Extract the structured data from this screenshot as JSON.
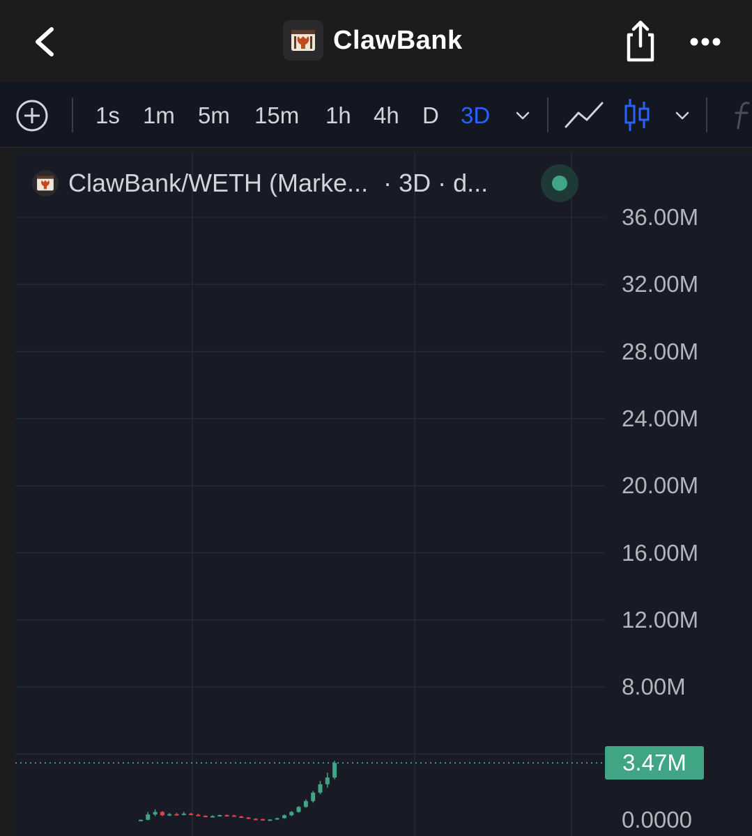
{
  "navbar": {
    "title": "ClawBank"
  },
  "toolbar": {
    "timeframes": [
      "1s",
      "1m",
      "5m",
      "15m",
      "1h",
      "4h",
      "D",
      "3D"
    ],
    "active_timeframe": "3D"
  },
  "legend": {
    "symbol": "ClawBank/WETH (Marke...",
    "meta": "· 3D · d..."
  },
  "colors": {
    "accent": "#2962ff",
    "up": "#3fa584",
    "down": "#e0444f",
    "background": "#181a25"
  },
  "chart_data": {
    "type": "candlestick",
    "y_ticks": [
      "36.00M",
      "32.00M",
      "28.00M",
      "24.00M",
      "20.00M",
      "16.00M",
      "12.00M",
      "8.00M",
      "0.0000"
    ],
    "last_price_label": "3.47M",
    "last_price": 3470000,
    "ylim": [
      0,
      36000000
    ],
    "candles": [
      {
        "o": 0.05,
        "h": 0.1,
        "l": 0.02,
        "c": 0.08
      },
      {
        "o": 0.08,
        "h": 0.55,
        "l": 0.06,
        "c": 0.4
      },
      {
        "o": 0.4,
        "h": 0.7,
        "l": 0.3,
        "c": 0.55
      },
      {
        "o": 0.55,
        "h": 0.6,
        "l": 0.3,
        "c": 0.35
      },
      {
        "o": 0.35,
        "h": 0.48,
        "l": 0.3,
        "c": 0.42
      },
      {
        "o": 0.42,
        "h": 0.5,
        "l": 0.38,
        "c": 0.4
      },
      {
        "o": 0.4,
        "h": 0.55,
        "l": 0.35,
        "c": 0.45
      },
      {
        "o": 0.45,
        "h": 0.5,
        "l": 0.35,
        "c": 0.38
      },
      {
        "o": 0.38,
        "h": 0.45,
        "l": 0.3,
        "c": 0.32
      },
      {
        "o": 0.32,
        "h": 0.35,
        "l": 0.25,
        "c": 0.28
      },
      {
        "o": 0.28,
        "h": 0.35,
        "l": 0.24,
        "c": 0.3
      },
      {
        "o": 0.3,
        "h": 0.4,
        "l": 0.28,
        "c": 0.36
      },
      {
        "o": 0.36,
        "h": 0.4,
        "l": 0.3,
        "c": 0.34
      },
      {
        "o": 0.34,
        "h": 0.38,
        "l": 0.26,
        "c": 0.28
      },
      {
        "o": 0.28,
        "h": 0.32,
        "l": 0.2,
        "c": 0.22
      },
      {
        "o": 0.22,
        "h": 0.24,
        "l": 0.12,
        "c": 0.14
      },
      {
        "o": 0.14,
        "h": 0.18,
        "l": 0.1,
        "c": 0.12
      },
      {
        "o": 0.12,
        "h": 0.14,
        "l": 0.06,
        "c": 0.08
      },
      {
        "o": 0.08,
        "h": 0.12,
        "l": 0.06,
        "c": 0.1
      },
      {
        "o": 0.1,
        "h": 0.2,
        "l": 0.08,
        "c": 0.18
      },
      {
        "o": 0.18,
        "h": 0.4,
        "l": 0.15,
        "c": 0.35
      },
      {
        "o": 0.35,
        "h": 0.6,
        "l": 0.3,
        "c": 0.55
      },
      {
        "o": 0.55,
        "h": 0.9,
        "l": 0.5,
        "c": 0.85
      },
      {
        "o": 0.85,
        "h": 1.3,
        "l": 0.8,
        "c": 1.2
      },
      {
        "o": 1.2,
        "h": 1.8,
        "l": 1.1,
        "c": 1.7
      },
      {
        "o": 1.7,
        "h": 2.4,
        "l": 1.6,
        "c": 2.2
      },
      {
        "o": 2.2,
        "h": 2.9,
        "l": 2.0,
        "c": 2.6
      },
      {
        "o": 2.6,
        "h": 3.6,
        "l": 2.5,
        "c": 3.47
      }
    ]
  }
}
